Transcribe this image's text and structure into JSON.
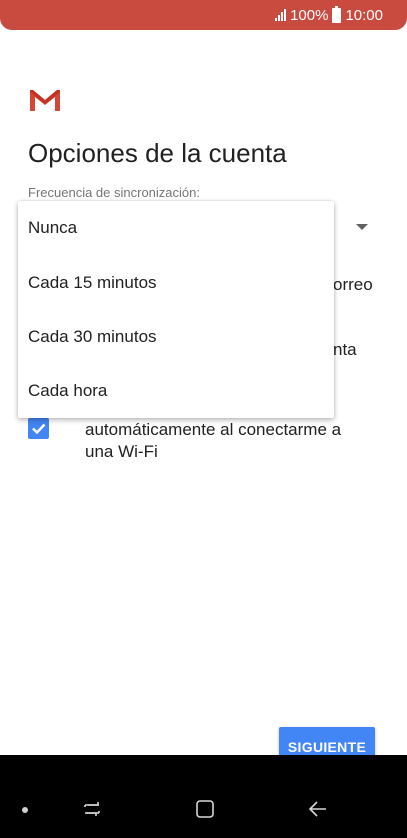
{
  "status_bar": {
    "battery_percent": "100%",
    "time": "10:00",
    "background_color": "#c94a3f"
  },
  "app": {
    "logo_icon": "gmail-logo-icon"
  },
  "page": {
    "title": "Opciones de la cuenta",
    "sync_frequency_label": "Frecuencia de sincronización:",
    "option_1_line_1_partial": "orreo",
    "option_2_line_1_partial": "nta",
    "option_3_line_1": "automáticamente al conectarme a",
    "option_3_line_2": "una Wi-Fi",
    "option_3_checked": true
  },
  "dropdown": {
    "options": [
      {
        "label": "Nunca"
      },
      {
        "label": "Cada 15 minutos"
      },
      {
        "label": "Cada 30 minutos"
      },
      {
        "label": "Cada hora"
      }
    ]
  },
  "footer": {
    "next_label": "SIGUIENTE",
    "accent_color": "#4285f4"
  },
  "nav_bar": {
    "icons": [
      "recents-icon",
      "home-icon",
      "back-icon"
    ]
  }
}
